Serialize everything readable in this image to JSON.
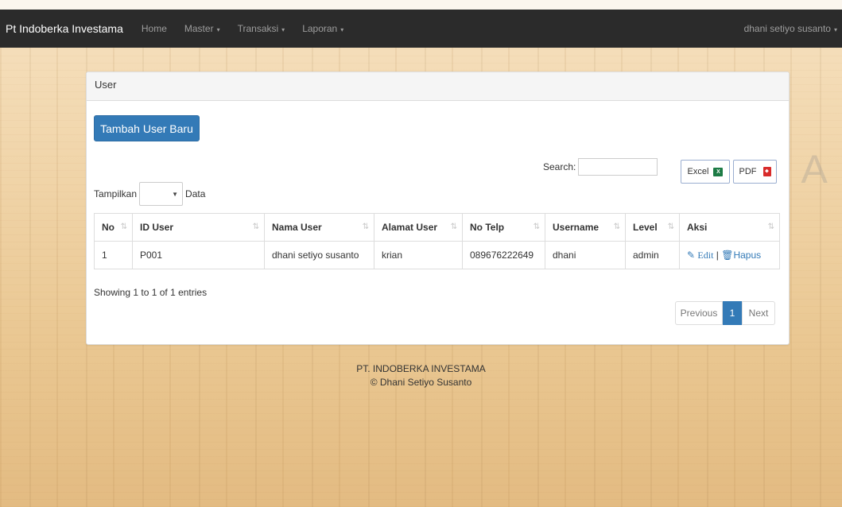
{
  "navbar": {
    "brand": "Pt Indoberka Investama",
    "items": [
      "Home",
      "Master",
      "Transaksi",
      "Laporan"
    ],
    "user": "dhani setiyo susanto",
    "bg_color": "#2b2b2b"
  },
  "panel": {
    "heading": "User"
  },
  "add_button": "Tambah User Baru",
  "length_menu": {
    "prefix": "Tampilkan",
    "suffix": "Data"
  },
  "search": {
    "label": "Search:"
  },
  "export": {
    "excel": "Excel",
    "pdf": "PDF"
  },
  "table": {
    "headers": [
      "No",
      "ID User",
      "Nama User",
      "Alamat User",
      "No Telp",
      "Username",
      "Level",
      "Aksi"
    ],
    "rows": [
      {
        "no": "1",
        "id": "P001",
        "nama": "dhani setiyo susanto",
        "alamat": "krian",
        "telp": "089676222649",
        "username": "dhani",
        "level": "admin"
      }
    ],
    "edit": "Edit",
    "separator": "|",
    "delete": "Hapus"
  },
  "info": "Showing 1 to 1 of 1 entries",
  "pagination": {
    "prev": "Previous",
    "current": "1",
    "next": "Next"
  },
  "footer": {
    "line1": "PT. INDOBERKA INVESTAMA",
    "line2": "© Dhani Setiyo Susanto"
  },
  "watermark": "SURABAYA",
  "colors": {
    "accent": "#337ab7",
    "navbar": "#2b2b2b"
  }
}
